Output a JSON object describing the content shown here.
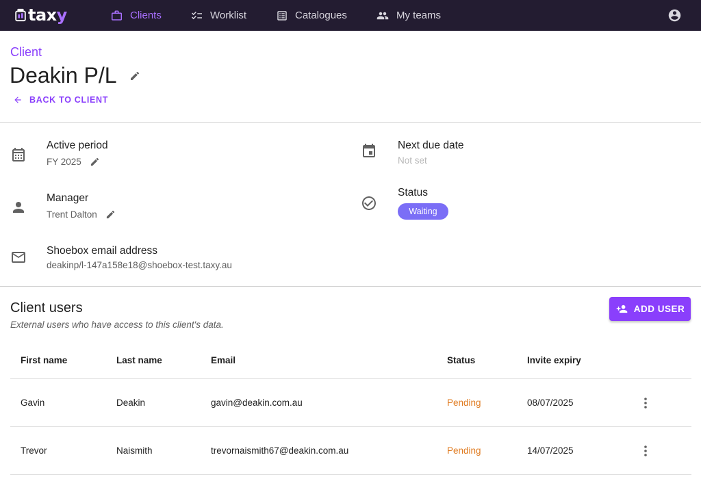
{
  "app": {
    "logo_prefix": "tax",
    "logo_suffix": "y"
  },
  "nav": {
    "items": [
      {
        "label": "Clients",
        "icon": "briefcase-icon",
        "active": true
      },
      {
        "label": "Worklist",
        "icon": "checklist-icon",
        "active": false
      },
      {
        "label": "Catalogues",
        "icon": "catalogue-icon",
        "active": false
      },
      {
        "label": "My teams",
        "icon": "group-icon",
        "active": false
      }
    ],
    "account_icon": "account-circle-icon"
  },
  "header": {
    "eyebrow": "Client",
    "client_name": "Deakin P/L",
    "back_label": "BACK TO CLIENT"
  },
  "details": {
    "active_period": {
      "label": "Active period",
      "value": "FY 2025"
    },
    "manager": {
      "label": "Manager",
      "value": "Trent Dalton"
    },
    "shoebox": {
      "label": "Shoebox email address",
      "value": "deakinp/l-147a158e18@shoebox-test.taxy.au"
    },
    "next_due": {
      "label": "Next due date",
      "value": "Not set"
    },
    "status": {
      "label": "Status",
      "value": "Waiting"
    }
  },
  "users": {
    "title": "Client users",
    "subtitle": "External users who have access to this client's data.",
    "add_label": "ADD USER",
    "columns": [
      "First name",
      "Last name",
      "Email",
      "Status",
      "Invite expiry"
    ],
    "rows": [
      {
        "first": "Gavin",
        "last": "Deakin",
        "email": "gavin@deakin.com.au",
        "status": "Pending",
        "expiry": "08/07/2025"
      },
      {
        "first": "Trevor",
        "last": "Naismith",
        "email": "trevornaismith67@deakin.com.au",
        "status": "Pending",
        "expiry": "14/07/2025"
      }
    ]
  },
  "colors": {
    "brand": "#8a3ffc",
    "nav_bg": "#231c31",
    "status_chip": "#7b6ef6",
    "pending": "#e07b20"
  }
}
